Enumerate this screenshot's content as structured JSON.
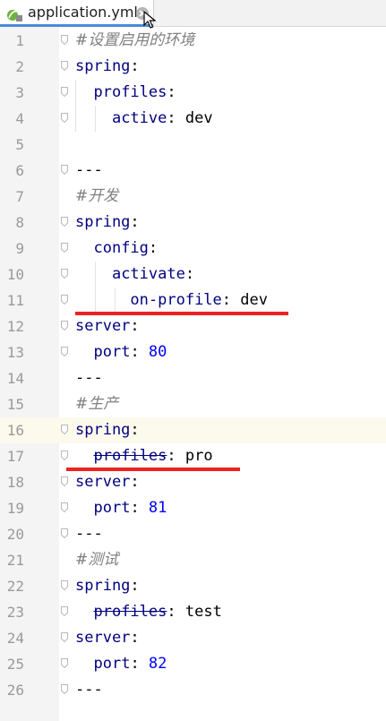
{
  "tab": {
    "title": "application.yml"
  },
  "lines": [
    {
      "n": "1",
      "tokens": [
        {
          "t": "#设置启用的环境",
          "c": "comment"
        }
      ]
    },
    {
      "n": "2",
      "tokens": [
        {
          "t": "spring",
          "c": "key"
        },
        {
          "t": ":",
          "c": "colon"
        }
      ]
    },
    {
      "n": "3",
      "tokens": [
        {
          "t": "  "
        },
        {
          "t": "profiles",
          "c": "key"
        },
        {
          "t": ":",
          "c": "colon"
        }
      ]
    },
    {
      "n": "4",
      "tokens": [
        {
          "t": "    "
        },
        {
          "t": "active",
          "c": "key"
        },
        {
          "t": ": ",
          "c": "colon"
        },
        {
          "t": "dev",
          "c": "val"
        }
      ]
    },
    {
      "n": "5",
      "tokens": []
    },
    {
      "n": "6",
      "tokens": [
        {
          "t": "---",
          "c": "val"
        }
      ]
    },
    {
      "n": "7",
      "tokens": [
        {
          "t": "#开发",
          "c": "comment"
        }
      ]
    },
    {
      "n": "8",
      "tokens": [
        {
          "t": "spring",
          "c": "key"
        },
        {
          "t": ":",
          "c": "colon"
        }
      ]
    },
    {
      "n": "9",
      "tokens": [
        {
          "t": "  "
        },
        {
          "t": "config",
          "c": "key"
        },
        {
          "t": ":",
          "c": "colon"
        }
      ]
    },
    {
      "n": "10",
      "tokens": [
        {
          "t": "    "
        },
        {
          "t": "activate",
          "c": "key"
        },
        {
          "t": ":",
          "c": "colon"
        }
      ]
    },
    {
      "n": "11",
      "tokens": [
        {
          "t": "      "
        },
        {
          "t": "on-profile",
          "c": "key"
        },
        {
          "t": ": ",
          "c": "colon"
        },
        {
          "t": "dev",
          "c": "val"
        }
      ]
    },
    {
      "n": "12",
      "tokens": [
        {
          "t": "server",
          "c": "key"
        },
        {
          "t": ":",
          "c": "colon"
        }
      ]
    },
    {
      "n": "13",
      "tokens": [
        {
          "t": "  "
        },
        {
          "t": "port",
          "c": "key"
        },
        {
          "t": ": ",
          "c": "colon"
        },
        {
          "t": "80",
          "c": "num"
        }
      ]
    },
    {
      "n": "14",
      "tokens": [
        {
          "t": "---",
          "c": "val"
        }
      ]
    },
    {
      "n": "15",
      "tokens": [
        {
          "t": "#生产",
          "c": "comment"
        }
      ]
    },
    {
      "n": "16",
      "tokens": [
        {
          "t": "spring",
          "c": "key"
        },
        {
          "t": ":",
          "c": "colon"
        }
      ],
      "highlight": true
    },
    {
      "n": "17",
      "tokens": [
        {
          "t": "  "
        },
        {
          "t": "profiles",
          "c": "key deprecated"
        },
        {
          "t": ": ",
          "c": "colon"
        },
        {
          "t": "pro",
          "c": "val"
        }
      ]
    },
    {
      "n": "18",
      "tokens": [
        {
          "t": "server",
          "c": "key"
        },
        {
          "t": ":",
          "c": "colon"
        }
      ]
    },
    {
      "n": "19",
      "tokens": [
        {
          "t": "  "
        },
        {
          "t": "port",
          "c": "key"
        },
        {
          "t": ": ",
          "c": "colon"
        },
        {
          "t": "81",
          "c": "num"
        }
      ]
    },
    {
      "n": "20",
      "tokens": [
        {
          "t": "---",
          "c": "val"
        }
      ]
    },
    {
      "n": "21",
      "tokens": [
        {
          "t": "#测试",
          "c": "comment"
        }
      ]
    },
    {
      "n": "22",
      "tokens": [
        {
          "t": "spring",
          "c": "key"
        },
        {
          "t": ":",
          "c": "colon"
        }
      ]
    },
    {
      "n": "23",
      "tokens": [
        {
          "t": "  "
        },
        {
          "t": "profiles",
          "c": "key deprecated"
        },
        {
          "t": ": ",
          "c": "colon"
        },
        {
          "t": "test",
          "c": "val"
        }
      ]
    },
    {
      "n": "24",
      "tokens": [
        {
          "t": "server",
          "c": "key"
        },
        {
          "t": ":",
          "c": "colon"
        }
      ]
    },
    {
      "n": "25",
      "tokens": [
        {
          "t": "  "
        },
        {
          "t": "port",
          "c": "key"
        },
        {
          "t": ": ",
          "c": "colon"
        },
        {
          "t": "82",
          "c": "num"
        }
      ]
    },
    {
      "n": "26",
      "tokens": [
        {
          "t": "---",
          "c": "val"
        }
      ]
    }
  ],
  "colors": {
    "accent": "#4a89dc",
    "annotation": "#ee2222",
    "key": "#000080",
    "number": "#0000ff",
    "comment": "#808080"
  }
}
